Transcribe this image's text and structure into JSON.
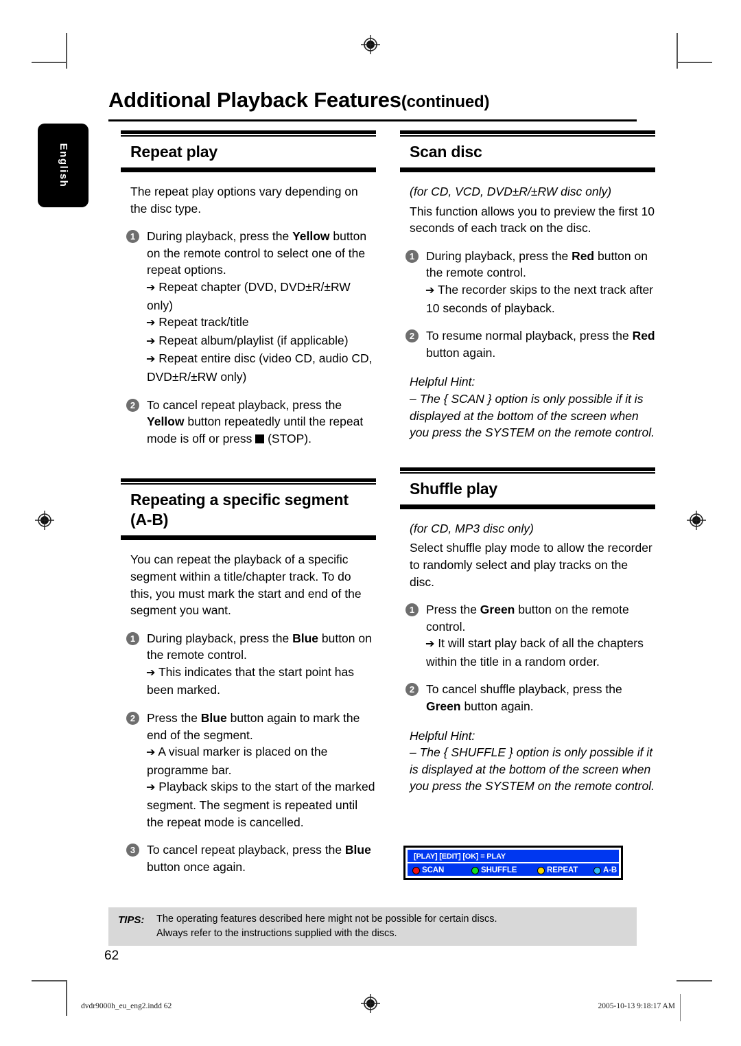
{
  "header": {
    "title": "Additional Playback Features",
    "continued": "(continued)",
    "language_tab": "English"
  },
  "sections": {
    "repeat_play": {
      "heading": "Repeat play",
      "intro": "The repeat play options vary depending on the disc type.",
      "steps": [
        {
          "num": "1",
          "text_before": "During playback, press the ",
          "bold": "Yellow",
          "text_after": " button on the remote control to select one of the repeat options.",
          "subs": [
            "Repeat chapter (DVD, DVD±R/±RW only)",
            "Repeat track/title",
            "Repeat album/playlist (if applicable)",
            "Repeat entire disc (video CD, audio CD, DVD±R/±RW only)"
          ]
        },
        {
          "num": "2",
          "text_before": "To cancel repeat playback, press the ",
          "bold": "Yellow",
          "text_after": " button repeatedly until the repeat mode is off or press",
          "text_end": "(STOP).",
          "subs": []
        }
      ]
    },
    "repeating_segment": {
      "heading_line1": "Repeating a specific segment",
      "heading_line2": "(A-B)",
      "intro": "You can repeat the playback of a specific segment within a title/chapter track. To do this, you must mark the start and end of the segment you want.",
      "steps": [
        {
          "num": "1",
          "text_before": "During playback, press the ",
          "bold": "Blue",
          "text_after": " button on the remote control.",
          "subs": [
            "This indicates that the start point has been marked."
          ]
        },
        {
          "num": "2",
          "text_before": "Press the ",
          "bold": "Blue",
          "text_after": " button again to mark the end of the segment.",
          "subs": [
            "A visual marker is placed on the programme bar.",
            "Playback skips to the start of the marked segment. The segment is repeated until the repeat mode is cancelled."
          ]
        },
        {
          "num": "3",
          "text_before": "To cancel repeat playback, press the ",
          "bold": "Blue",
          "text_after": " button once again.",
          "subs": []
        }
      ]
    },
    "scan_disc": {
      "heading": "Scan disc",
      "applies_to": "(for CD, VCD, DVD±R/±RW disc only)",
      "intro": "This function allows you to preview the first 10 seconds of each track on the disc.",
      "steps": [
        {
          "num": "1",
          "text_before": "During playback, press the ",
          "bold": "Red",
          "text_after": " button on the remote control.",
          "subs": [
            "The recorder skips to the next track after 10 seconds of playback."
          ]
        },
        {
          "num": "2",
          "text_before": "To resume normal playback, press the ",
          "bold": "Red",
          "text_after": " button again.",
          "subs": []
        }
      ],
      "hint_title": "Helpful Hint:",
      "hint_body": "– The { SCAN } option is only possible if it is displayed at the bottom of the screen when you press the SYSTEM on the remote control."
    },
    "shuffle_play": {
      "heading": "Shuffle play",
      "applies_to": "(for CD, MP3 disc only)",
      "intro": "Select shuffle play mode to allow the recorder to randomly select and play tracks on the disc.",
      "steps": [
        {
          "num": "1",
          "text_before": "Press the ",
          "bold": "Green",
          "text_after": " button on the remote control.",
          "subs": [
            "It will start play back of all the chapters within the title in a random order."
          ]
        },
        {
          "num": "2",
          "text_before": "To cancel shuffle playback, press the ",
          "bold": "Green",
          "text_after": " button again.",
          "subs": []
        }
      ],
      "hint_title": "Helpful Hint:",
      "hint_body": "– The { SHUFFLE } option is only possible if it is displayed at the bottom of the screen when you press the SYSTEM on the remote control."
    }
  },
  "osd": {
    "status_line": "[PLAY] [EDIT] [OK] = PLAY",
    "buttons": [
      {
        "label": "SCAN",
        "color": "#ee1111"
      },
      {
        "label": "SHUFFLE",
        "color": "#11dd22"
      },
      {
        "label": "REPEAT",
        "color": "#f5d400"
      },
      {
        "label": "A-B",
        "color": "#33bbf5"
      }
    ],
    "background": "#0037f0"
  },
  "tips": {
    "label": "TIPS:",
    "line1": "The operating features described here might not be possible for certain discs.",
    "line2": "Always refer to the instructions supplied with the discs."
  },
  "page_number": "62",
  "print_footer": {
    "file": "dvdr9000h_eu_eng2.indd   62",
    "timestamp": "2005-10-13   9:18:17 AM"
  }
}
